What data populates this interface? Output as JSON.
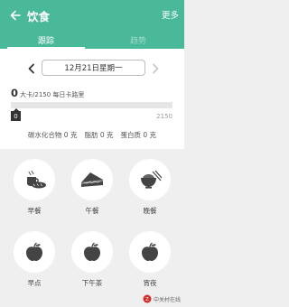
{
  "header": {
    "title": "饮食",
    "more_label": "更多"
  },
  "tabs": [
    {
      "label": "跟踪"
    },
    {
      "label": "趋势"
    }
  ],
  "date": {
    "label": "12月21日星期一"
  },
  "calories": {
    "consumed": "0",
    "detail": "大卡/2150 每日卡路里",
    "progress_fraction": 0,
    "marker_value": "0",
    "goal_value": "2150"
  },
  "nutrients": [
    {
      "label": "碳水化合物 0 克"
    },
    {
      "label": "脂肪 0 克"
    },
    {
      "label": "蛋白质 0 克"
    }
  ],
  "meals": [
    {
      "label": "早餐",
      "icon": "bread-coffee-icon"
    },
    {
      "label": "午餐",
      "icon": "sandwich-icon"
    },
    {
      "label": "晚餐",
      "icon": "bowl-chopsticks-icon"
    },
    {
      "label": "早点",
      "icon": "apple-icon"
    },
    {
      "label": "下午茶",
      "icon": "apple-icon"
    },
    {
      "label": "宵夜",
      "icon": "apple-icon"
    }
  ],
  "watermark": {
    "text": "中关村在线"
  },
  "colors": {
    "accent": "#49b99a",
    "background": "#efefef"
  }
}
